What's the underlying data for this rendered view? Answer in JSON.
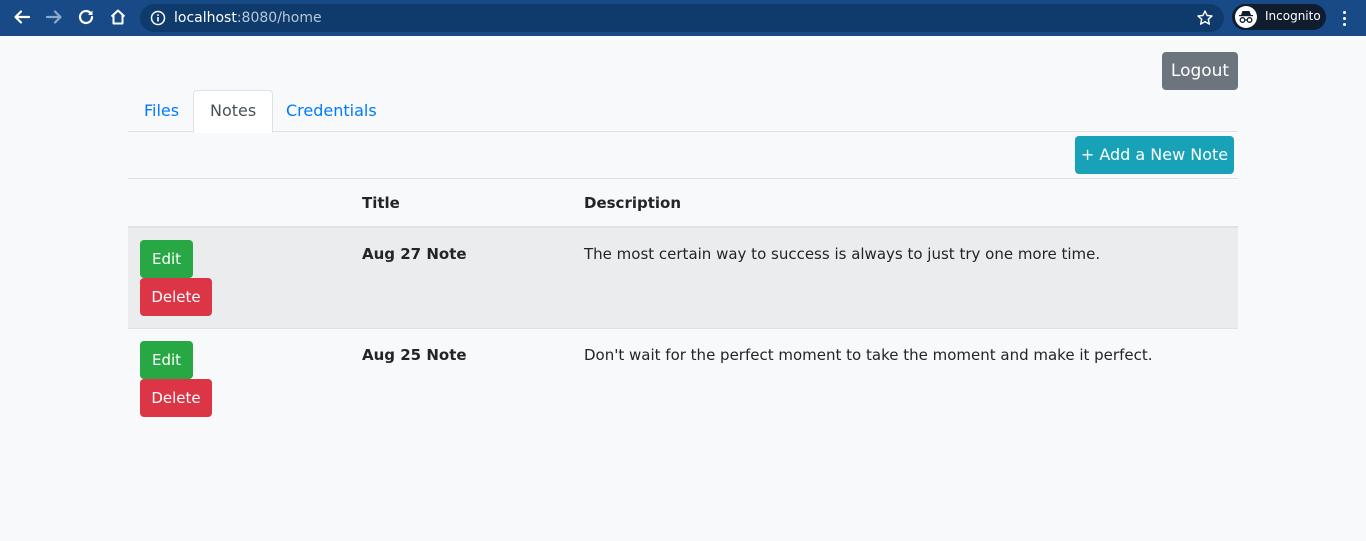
{
  "browser": {
    "url_host": "localhost",
    "url_rest": ":8080/home",
    "incognito_label": "Incognito",
    "icons": [
      "back-arrow-icon",
      "forward-arrow-icon",
      "reload-icon",
      "home-icon",
      "info-icon",
      "star-icon",
      "incognito-icon",
      "kebab-menu-icon"
    ]
  },
  "header": {
    "logout_label": "Logout"
  },
  "tabs": [
    {
      "label": "Files",
      "active": false
    },
    {
      "label": "Notes",
      "active": true
    },
    {
      "label": "Credentials",
      "active": false
    }
  ],
  "notes": {
    "add_label": "+ Add a New Note",
    "columns": [
      "",
      "Title",
      "Description"
    ],
    "rows": [
      {
        "edit_label": "Edit",
        "delete_label": "Delete",
        "title": "Aug 27 Note",
        "description": "The most certain way to success is always to just try one more time."
      },
      {
        "edit_label": "Edit",
        "delete_label": "Delete",
        "title": "Aug 25 Note",
        "description": "Don't wait for the perfect moment to take the moment and make it perfect."
      }
    ]
  },
  "colors": {
    "chrome_bar": "#174a86",
    "omnibox": "#0f3a6c",
    "logout": "#6c757d",
    "link": "#007bff",
    "add_button": "#17a2b8",
    "edit_button": "#28a745",
    "delete_button": "#dc3545"
  }
}
